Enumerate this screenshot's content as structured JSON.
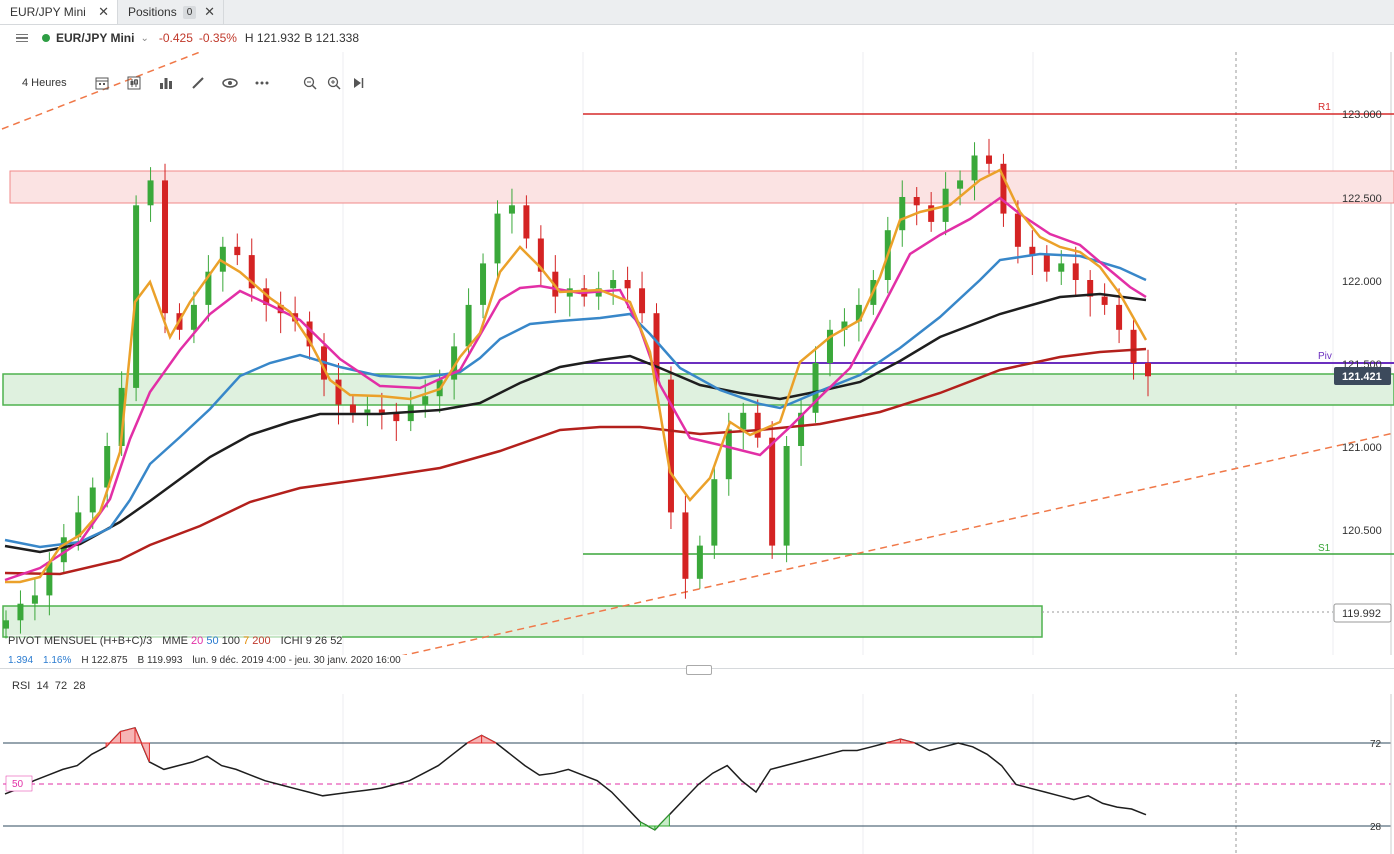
{
  "tabs": [
    {
      "label": "EUR/JPY Mini",
      "close": "✕"
    },
    {
      "label": "Positions",
      "badge": "0",
      "close": "✕"
    }
  ],
  "header": {
    "symbol": "EUR/JPY Mini",
    "change": "-0.425",
    "change_pct": "-0.35%",
    "high": "H 121.932",
    "bid": "B 121.338",
    "status_color": "#2e9e44"
  },
  "toolbar": {
    "timeframe": "4 Heures",
    "icons": [
      "calendar-icon",
      "candle-type-icon",
      "bar-chart-icon",
      "pencil-icon",
      "eye-icon",
      "more-icon",
      "zoom-out-icon",
      "zoom-in-icon",
      "play-icon"
    ]
  },
  "price_axis": {
    "ticks": [
      "123.000",
      "122.500",
      "122.000",
      "121.500",
      "121.000",
      "120.500"
    ],
    "current_price": "121.421",
    "low_marker": "119.992",
    "labels": {
      "r1": "R1",
      "piv": "Piv",
      "s1": "S1"
    }
  },
  "legend": {
    "pivot": "PIVOT",
    "pivot_type": "MENSUEL",
    "pivot_formula": "(H+B+C)/3",
    "mme": "MME",
    "mme_values": [
      "20",
      "50",
      "100",
      "7",
      "200"
    ],
    "ichi": "ICHI",
    "ichi_values": [
      "9",
      "26",
      "52"
    ],
    "range": "1.394",
    "range_pct": "1.16%",
    "high": "H 122.875",
    "low": "B 119.993",
    "period": "lun. 9 déc. 2019 4:00 - jeu. 30 janv. 2020 16:00"
  },
  "rsi": {
    "label": "RSI",
    "params": [
      "14",
      "72",
      "28"
    ],
    "levels": {
      "upper": "72",
      "mid": "50",
      "lower": "28"
    }
  },
  "chart_data": {
    "type": "candlestick",
    "instrument": "EUR/JPY Mini",
    "timeframe": "4 Heures",
    "ylim": [
      119.8,
      123.1
    ],
    "levels": {
      "R1": 123.0,
      "Piv": 121.52,
      "S1": 120.35
    },
    "zones": [
      {
        "from": 122.45,
        "to": 122.65,
        "color": "#f5a3a3"
      },
      {
        "from": 121.25,
        "to": 121.42,
        "color": "#9fd49f"
      },
      {
        "from": 119.8,
        "to": 119.99,
        "color": "#9fd49f"
      }
    ],
    "close_series": [
      119.95,
      120.05,
      120.1,
      120.3,
      120.45,
      120.6,
      120.75,
      121.0,
      121.35,
      122.45,
      122.6,
      121.8,
      121.7,
      121.85,
      122.05,
      122.2,
      122.15,
      121.95,
      121.85,
      121.8,
      121.75,
      121.6,
      121.4,
      121.25,
      121.2,
      121.22,
      121.2,
      121.15,
      121.25,
      121.3,
      121.4,
      121.6,
      121.85,
      122.1,
      122.4,
      122.45,
      122.25,
      122.05,
      121.9,
      121.95,
      121.9,
      121.95,
      122.0,
      121.95,
      121.8,
      121.4,
      120.6,
      120.2,
      120.4,
      120.8,
      121.1,
      121.2,
      121.05,
      120.4,
      121.0,
      121.2,
      121.5,
      121.7,
      121.75,
      121.85,
      122.0,
      122.3,
      122.5,
      122.45,
      122.35,
      122.55,
      122.6,
      122.75,
      122.7,
      122.4,
      122.2,
      122.15,
      122.05,
      122.1,
      122.0,
      121.9,
      121.85,
      121.7,
      121.5,
      121.42
    ],
    "rsi_series": [
      45,
      48,
      52,
      55,
      58,
      60,
      66,
      70,
      78,
      80,
      62,
      58,
      60,
      62,
      65,
      60,
      58,
      55,
      52,
      50,
      48,
      46,
      44,
      45,
      46,
      47,
      48,
      50,
      52,
      56,
      60,
      66,
      72,
      76,
      72,
      66,
      60,
      55,
      56,
      58,
      55,
      52,
      46,
      38,
      30,
      26,
      34,
      42,
      50,
      56,
      60,
      52,
      46,
      58,
      60,
      62,
      64,
      66,
      68,
      68,
      70,
      72,
      74,
      72,
      68,
      70,
      72,
      70,
      66,
      60,
      50,
      48,
      46,
      44,
      42,
      44,
      40,
      38,
      37,
      34
    ]
  }
}
